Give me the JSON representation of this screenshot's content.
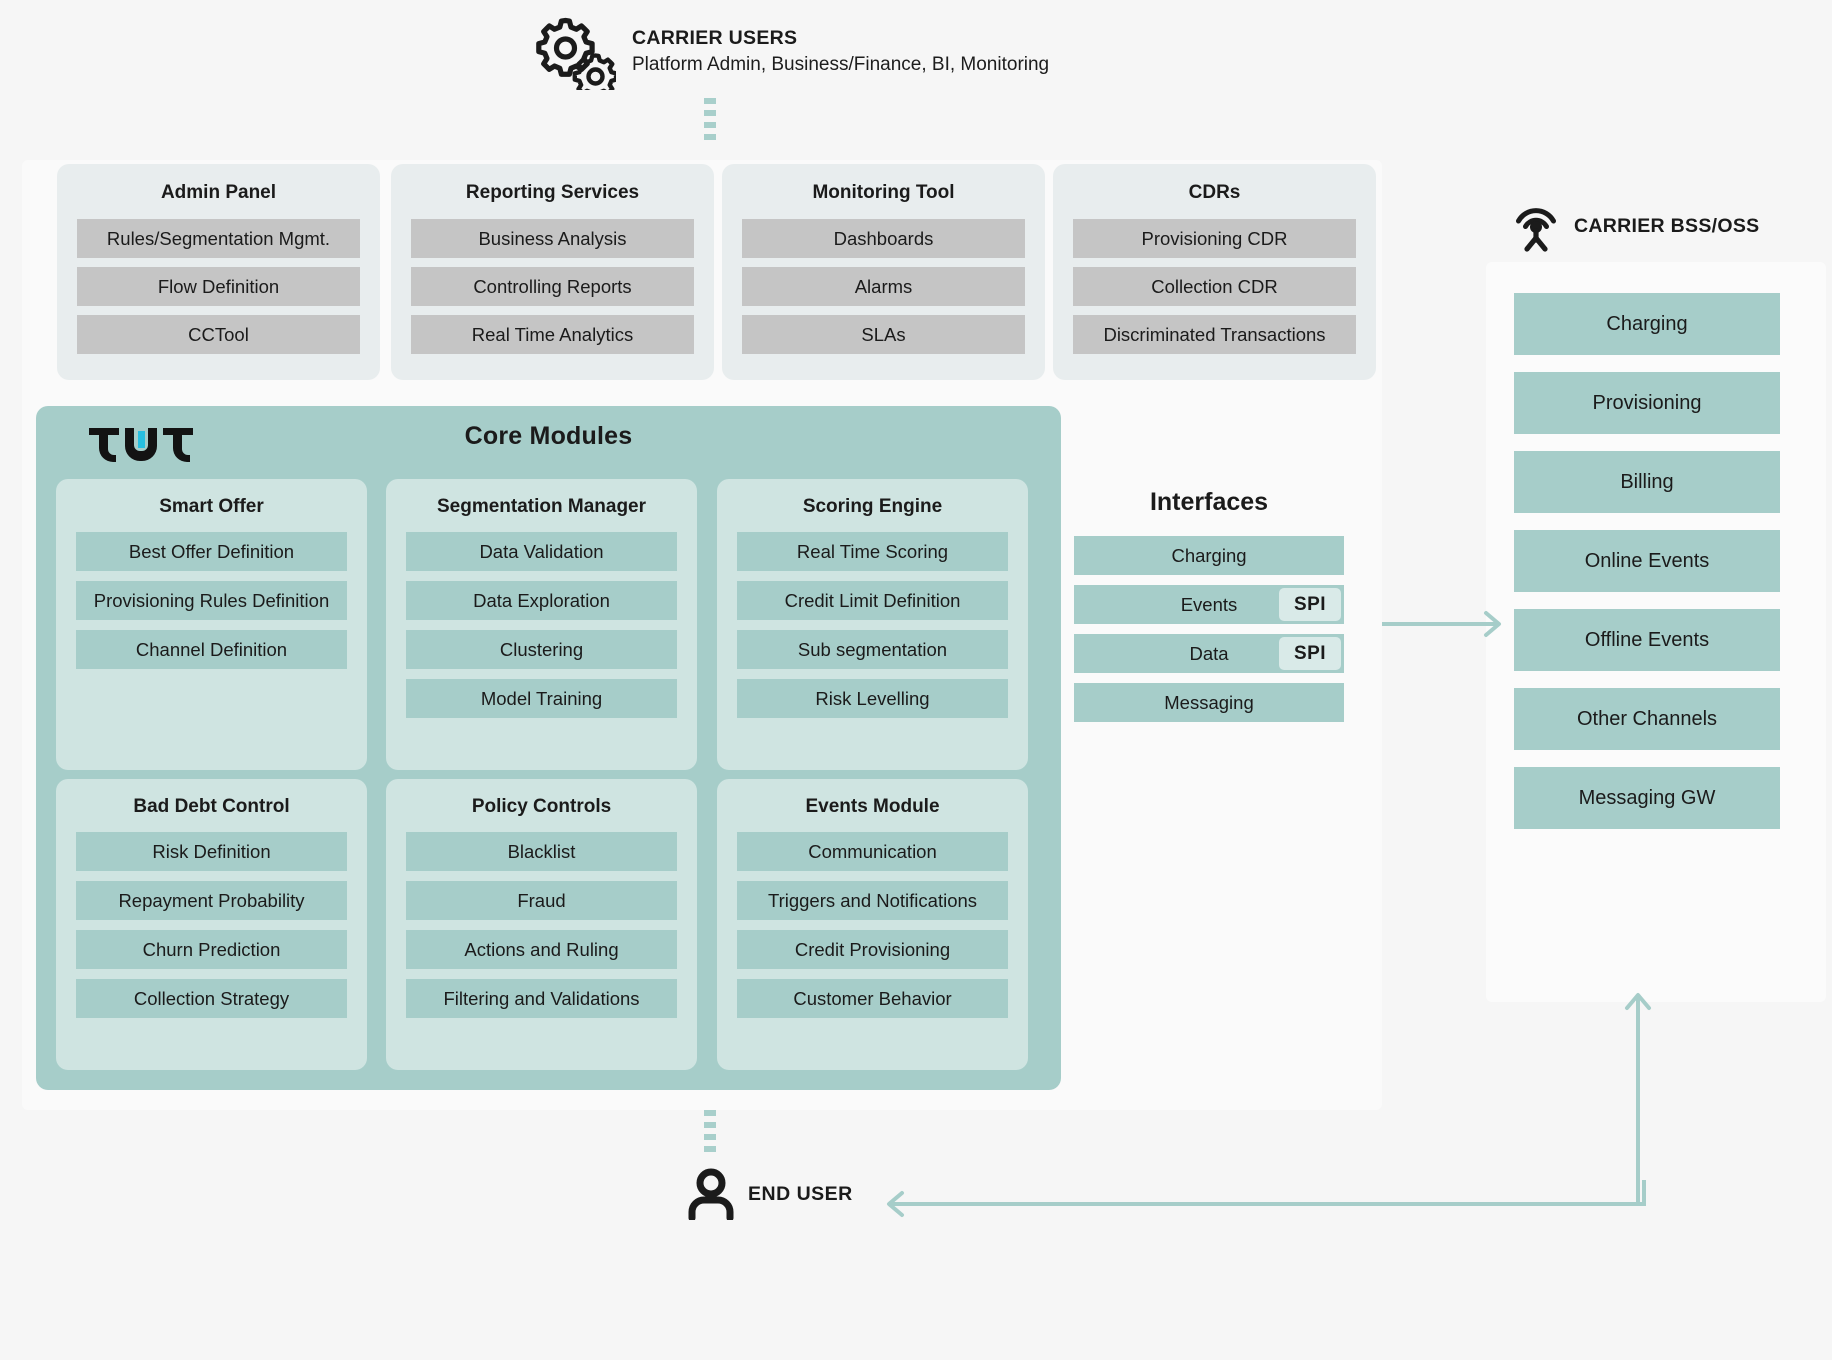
{
  "header": {
    "icon": "gears-icon",
    "title": "CARRIER USERS",
    "subtitle": "Platform Admin, Business/Finance, BI, Monitoring"
  },
  "top_row": [
    {
      "title": "Admin Panel",
      "items": [
        "Rules/Segmentation Mgmt.",
        "Flow Definition",
        "CCTool"
      ]
    },
    {
      "title": "Reporting Services",
      "items": [
        "Business Analysis",
        "Controlling Reports",
        "Real Time Analytics"
      ]
    },
    {
      "title": "Monitoring Tool",
      "items": [
        "Dashboards",
        "Alarms",
        "SLAs"
      ]
    },
    {
      "title": "CDRs",
      "items": [
        "Provisioning CDR",
        "Collection CDR",
        "Discriminated Transactions"
      ]
    }
  ],
  "core": {
    "title": "Core Modules",
    "logo": "twt-logo",
    "cards": [
      {
        "title": "Smart Offer",
        "items": [
          "Best Offer Definition",
          "Provisioning Rules Definition",
          "Channel Definition"
        ]
      },
      {
        "title": "Segmentation Manager",
        "items": [
          "Data Validation",
          "Data Exploration",
          "Clustering",
          "Model Training"
        ]
      },
      {
        "title": "Scoring Engine",
        "items": [
          "Real Time Scoring",
          "Credit Limit Definition",
          "Sub segmentation",
          "Risk Levelling"
        ]
      },
      {
        "title": "Bad Debt Control",
        "items": [
          "Risk Definition",
          "Repayment Probability",
          "Churn Prediction",
          "Collection Strategy"
        ]
      },
      {
        "title": "Policy Controls",
        "items": [
          "Blacklist",
          "Fraud",
          "Actions and Ruling",
          "Filtering and Validations"
        ]
      },
      {
        "title": "Events Module",
        "items": [
          "Communication",
          "Triggers and Notifications",
          "Credit Provisioning",
          "Customer Behavior"
        ]
      }
    ]
  },
  "interfaces": {
    "title": "Interfaces",
    "items": [
      {
        "label": "Charging",
        "badge": ""
      },
      {
        "label": "Events",
        "badge": "SPI"
      },
      {
        "label": "Data",
        "badge": "SPI"
      },
      {
        "label": "Messaging",
        "badge": ""
      }
    ]
  },
  "bss": {
    "icon": "antenna-icon",
    "title": "CARRIER BSS/OSS",
    "items": [
      "Charging",
      "Provisioning",
      "Billing",
      "Online Events",
      "Offline Events",
      "Other Channels",
      "Messaging GW"
    ]
  },
  "end_user": {
    "icon": "person-icon",
    "title": "END USER"
  },
  "colors": {
    "background": "#f6f6f6",
    "teal_panel": "#a6cdc9",
    "teal_card": "#cfe4e1",
    "teal_badge": "#d9eae8",
    "gray_card": "#e8edee",
    "gray_chip": "#c5c5c5",
    "logo_accent": "#27bfe0",
    "connector": "#a6cdc9"
  }
}
